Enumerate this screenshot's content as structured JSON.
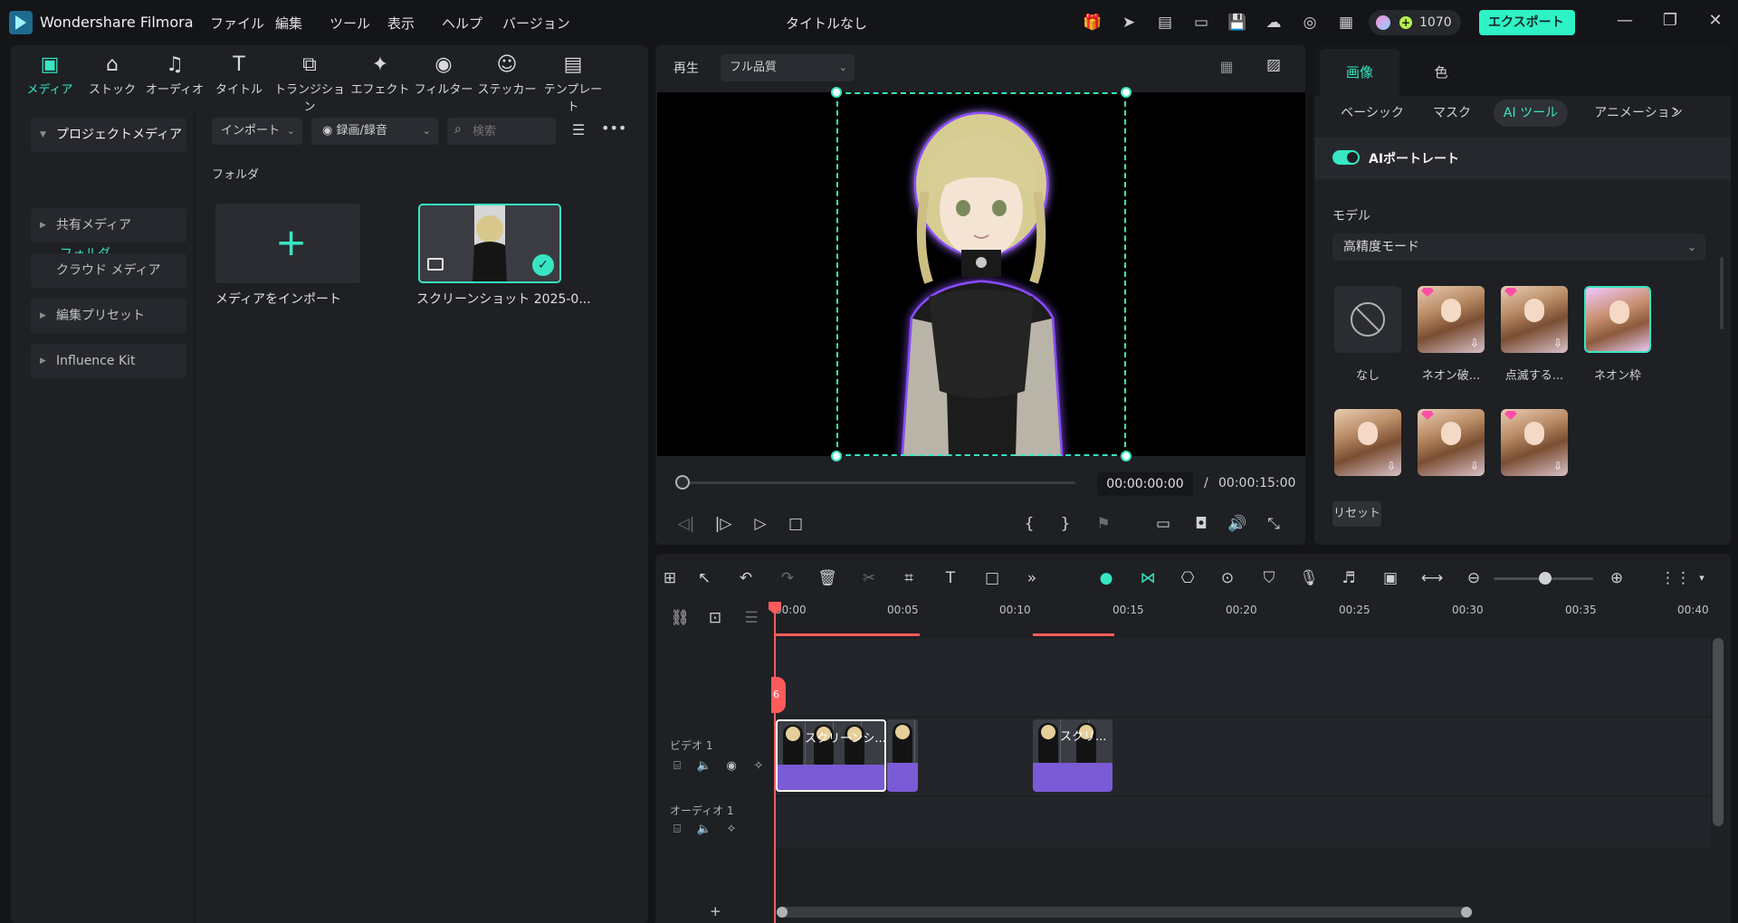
{
  "titlebar": {
    "app_name": "Wondershare Filmora",
    "menu": [
      "ファイル",
      "編集",
      "ツール",
      "表示",
      "ヘルプ",
      "バージョン"
    ],
    "doc_title": "タイトルなし",
    "credits": "1070",
    "export_label": "エクスポート"
  },
  "media_tabs": [
    {
      "label": "メディア",
      "icon": "media-icon"
    },
    {
      "label": "ストック",
      "icon": "stock-icon"
    },
    {
      "label": "オーディオ",
      "icon": "audio-icon"
    },
    {
      "label": "タイトル",
      "icon": "title-icon"
    },
    {
      "label": "トランジション",
      "icon": "transition-icon"
    },
    {
      "label": "エフェクト",
      "icon": "effect-icon"
    },
    {
      "label": "フィルター",
      "icon": "filter-icon"
    },
    {
      "label": "ステッカー",
      "icon": "sticker-icon"
    },
    {
      "label": "テンプレート",
      "icon": "template-icon"
    }
  ],
  "sidebar": {
    "project_media": "プロジェクトメディア",
    "folder": "フォルダ",
    "items": [
      "共有メディア",
      "クラウド メディア",
      "編集プリセット",
      "Influence Kit"
    ]
  },
  "media": {
    "import_label": "インポート",
    "record_label": "録画/録音",
    "search_placeholder": "検索",
    "folder_label": "フォルダ",
    "import_tile_label": "メディアをインポート",
    "clip_label": "スクリーンショット 2025-0..."
  },
  "preview": {
    "play_label": "再生",
    "quality": "フル品質",
    "current_time": "00:00:00:00",
    "separator": "/",
    "total_time": "00:00:15:00"
  },
  "right_panel": {
    "tabs": [
      "画像",
      "色"
    ],
    "sub_tabs": [
      "ベーシック",
      "マスク",
      "AI ツール",
      "アニメーション"
    ],
    "ai_portrait": "AIポートレート",
    "model_label": "モデル",
    "model_value": "高精度モード",
    "effects": [
      {
        "label": "なし"
      },
      {
        "label": "ネオン破..."
      },
      {
        "label": "点滅する..."
      },
      {
        "label": "ネオン枠"
      }
    ],
    "reset_label": "リセット"
  },
  "timeline": {
    "ticks": [
      "00:00",
      "00:05",
      "00:10",
      "00:15",
      "00:20",
      "00:25",
      "00:30",
      "00:35",
      "00:40"
    ],
    "video_track": "ビデオ 1",
    "audio_track": "オーディオ 1",
    "clip1_label": "スクリーンシ...",
    "clip2_label": "スクリ...",
    "add_track": "+",
    "marker": "6"
  },
  "colors": {
    "accent": "#37e6c2",
    "playhead": "#ff5b5b",
    "clip": "#7b5ad6"
  }
}
